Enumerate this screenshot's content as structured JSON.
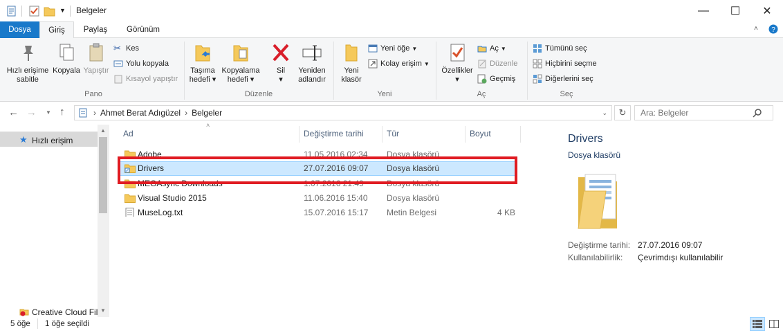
{
  "window": {
    "title": "Belgeler",
    "minimize_glyph": "—",
    "maximize_glyph": "☐",
    "close_glyph": "✕"
  },
  "tabs": [
    {
      "label": "Dosya"
    },
    {
      "label": "Giriş"
    },
    {
      "label": "Paylaş"
    },
    {
      "label": "Görünüm"
    }
  ],
  "ribbon": {
    "pano": {
      "label": "Pano",
      "pin": "Hızlı erişime sabitle",
      "pin_l1": "Hızlı erişime",
      "pin_l2": "sabitle",
      "copy": "Kopyala",
      "paste": "Yapıştır",
      "cut": "Kes",
      "copy_path": "Yolu kopyala",
      "paste_shortcut": "Kısayol yapıştır"
    },
    "duzenle": {
      "label": "Düzenle",
      "move_l1": "Taşıma",
      "move_l2": "hedefi",
      "copyto_l1": "Kopyalama",
      "copyto_l2": "hedefi",
      "delete": "Sil",
      "rename_l1": "Yeniden",
      "rename_l2": "adlandır"
    },
    "yeni": {
      "label": "Yeni",
      "newfolder_l1": "Yeni",
      "newfolder_l2": "klasör",
      "new_item": "Yeni öğe",
      "easy_access": "Kolay erişim"
    },
    "ac": {
      "label": "Aç",
      "properties": "Özellikler",
      "open": "Aç",
      "edit": "Düzenle",
      "history": "Geçmiş"
    },
    "sec": {
      "label": "Seç",
      "select_all": "Tümünü seç",
      "select_none": "Hiçbirini seçme",
      "invert": "Diğerlerini seç"
    }
  },
  "nav": {
    "crumbs": [
      "Ahmet Berat Adıgüzel",
      "Belgeler"
    ],
    "search_placeholder": "Ara: Belgeler"
  },
  "navpane": {
    "quick_access": "Hızlı erişim",
    "creative_cloud": "Creative Cloud Fil"
  },
  "columns": {
    "name": "Ad",
    "modified": "Değiştirme tarihi",
    "type": "Tür",
    "size": "Boyut"
  },
  "files": [
    {
      "name": "Adobe",
      "modified": "11.05.2016 02:34",
      "type": "Dosya klasörü",
      "size": "",
      "kind": "folder"
    },
    {
      "name": "Drivers",
      "modified": "27.07.2016 09:07",
      "type": "Dosya klasörü",
      "size": "",
      "kind": "folder-shortcut"
    },
    {
      "name": "MEGAsync Downloads",
      "modified": "1.07.2016 21:49",
      "type": "Dosya klasörü",
      "size": "",
      "kind": "folder"
    },
    {
      "name": "Visual Studio 2015",
      "modified": "11.06.2016 15:40",
      "type": "Dosya klasörü",
      "size": "",
      "kind": "folder"
    },
    {
      "name": "MuseLog.txt",
      "modified": "15.07.2016 15:17",
      "type": "Metin Belgesi",
      "size": "4 KB",
      "kind": "text"
    }
  ],
  "details": {
    "name": "Drivers",
    "type": "Dosya klasörü",
    "modified_label": "Değiştirme tarihi:",
    "modified_value": "27.07.2016 09:07",
    "availability_label": "Kullanılabilirlik:",
    "availability_value": "Çevrimdışı kullanılabilir"
  },
  "status": {
    "count": "5 öğe",
    "selected": "1 öğe seçildi"
  },
  "colors": {
    "accent": "#1979ca",
    "selection": "#cce8ff",
    "highlight_box": "#e01b22",
    "folder": "#f5c95b"
  }
}
